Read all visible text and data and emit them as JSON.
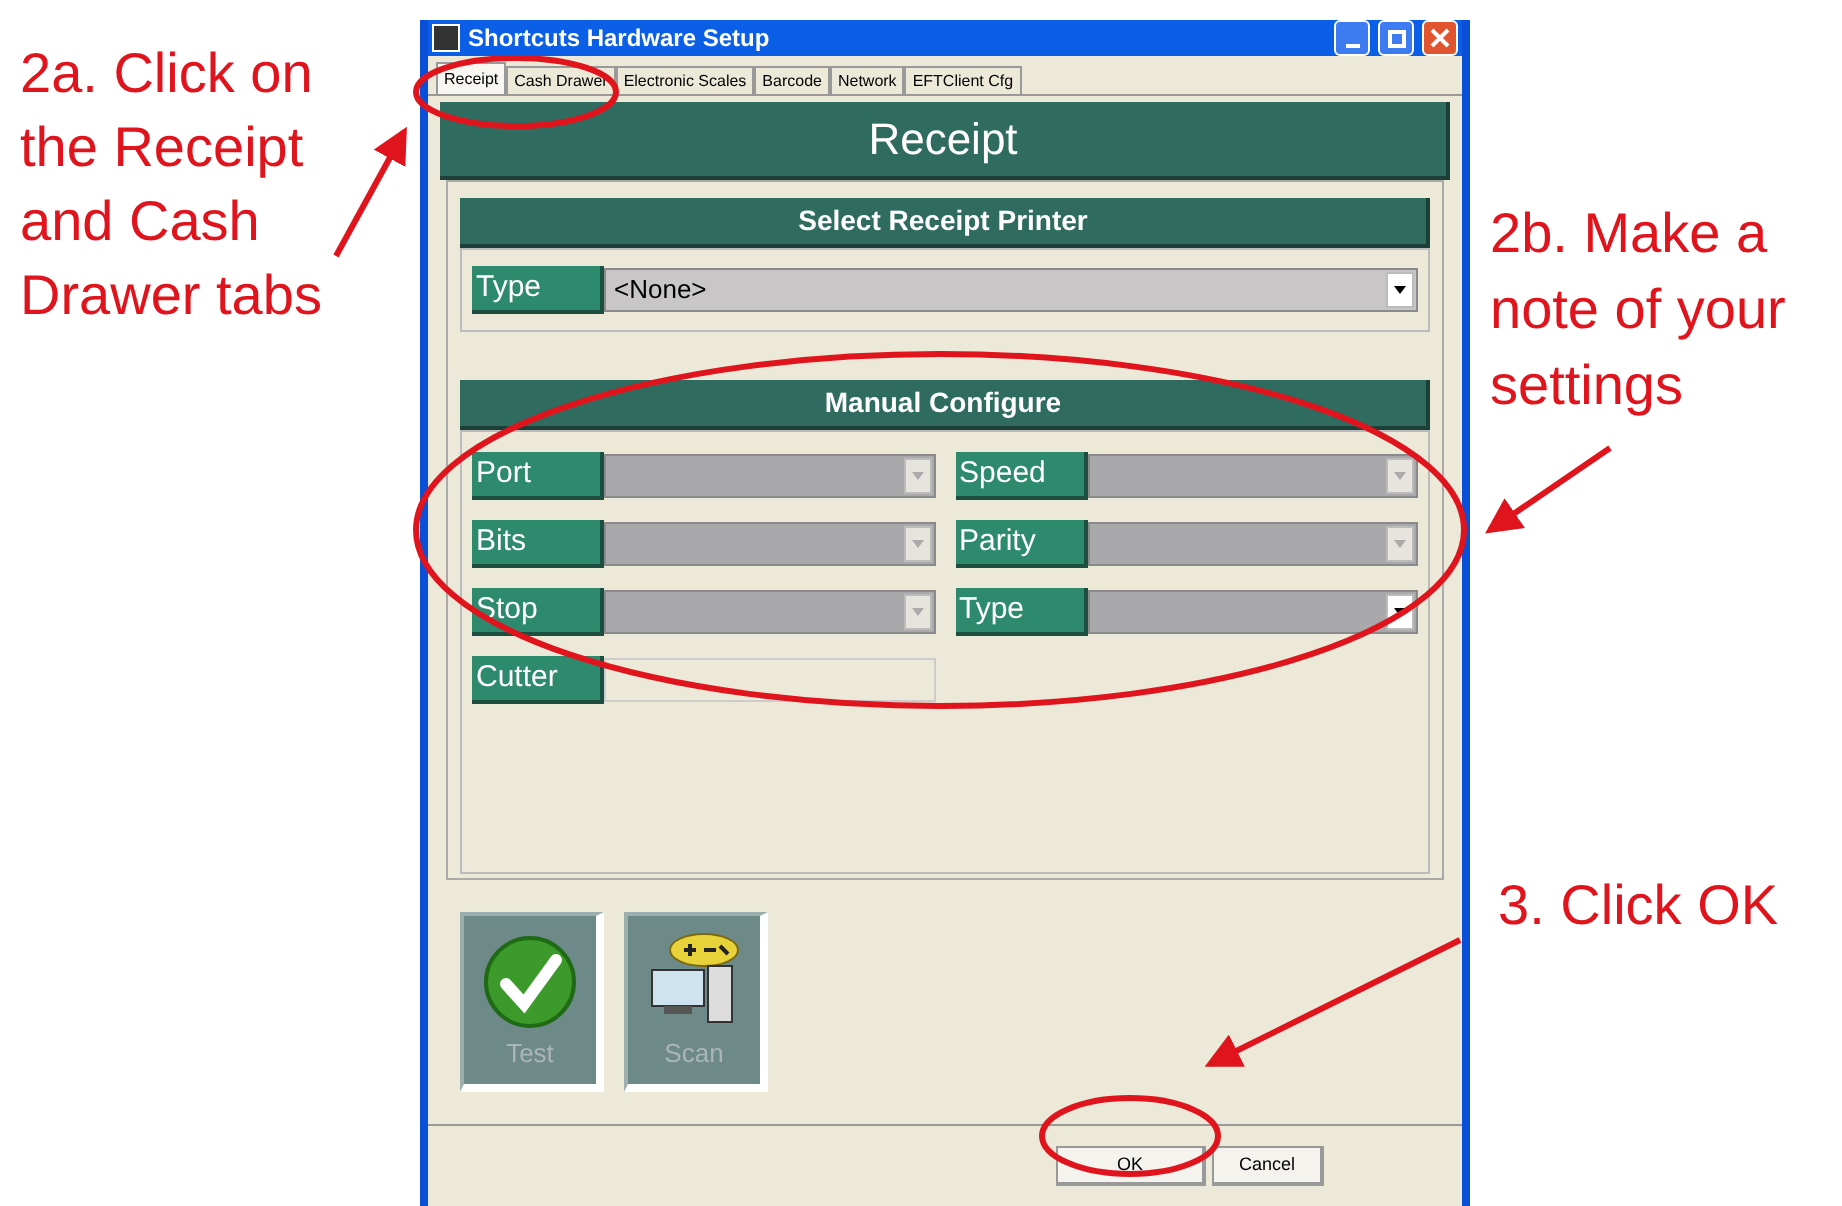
{
  "window": {
    "title": "Shortcuts Hardware Setup"
  },
  "tabs": [
    {
      "label": "Receipt",
      "selected": true
    },
    {
      "label": "Cash Drawer",
      "selected": false
    },
    {
      "label": "Electronic Scales",
      "selected": false
    },
    {
      "label": "Barcode",
      "selected": false
    },
    {
      "label": "Network",
      "selected": false
    },
    {
      "label": "EFTClient Cfg",
      "selected": false
    }
  ],
  "page_header": "Receipt",
  "printer_section": {
    "title": "Select Receipt Printer",
    "label": "Type",
    "value": "<None>"
  },
  "manual_section": {
    "title": "Manual Configure",
    "fields": [
      {
        "label": "Port",
        "kind": "dropdown",
        "disabled": true
      },
      {
        "label": "Speed",
        "kind": "dropdown",
        "disabled": true
      },
      {
        "label": "Bits",
        "kind": "dropdown",
        "disabled": true
      },
      {
        "label": "Parity",
        "kind": "dropdown",
        "disabled": true
      },
      {
        "label": "Stop",
        "kind": "dropdown",
        "disabled": true
      },
      {
        "label": "Type",
        "kind": "dropdown",
        "disabled": false
      },
      {
        "label": "Cutter",
        "kind": "text",
        "disabled": true
      }
    ]
  },
  "tool_buttons": [
    {
      "label": "Test",
      "kind": "check",
      "disabled": true
    },
    {
      "label": "Scan",
      "kind": "computer",
      "disabled": true
    }
  ],
  "buttons": [
    "OK",
    "Cancel"
  ],
  "annotations": {
    "left": "2a. Click on the Receipt and Cash Drawer tabs",
    "right_top": "2b. Make a note of your settings",
    "right_bottom": "3. Click OK"
  }
}
